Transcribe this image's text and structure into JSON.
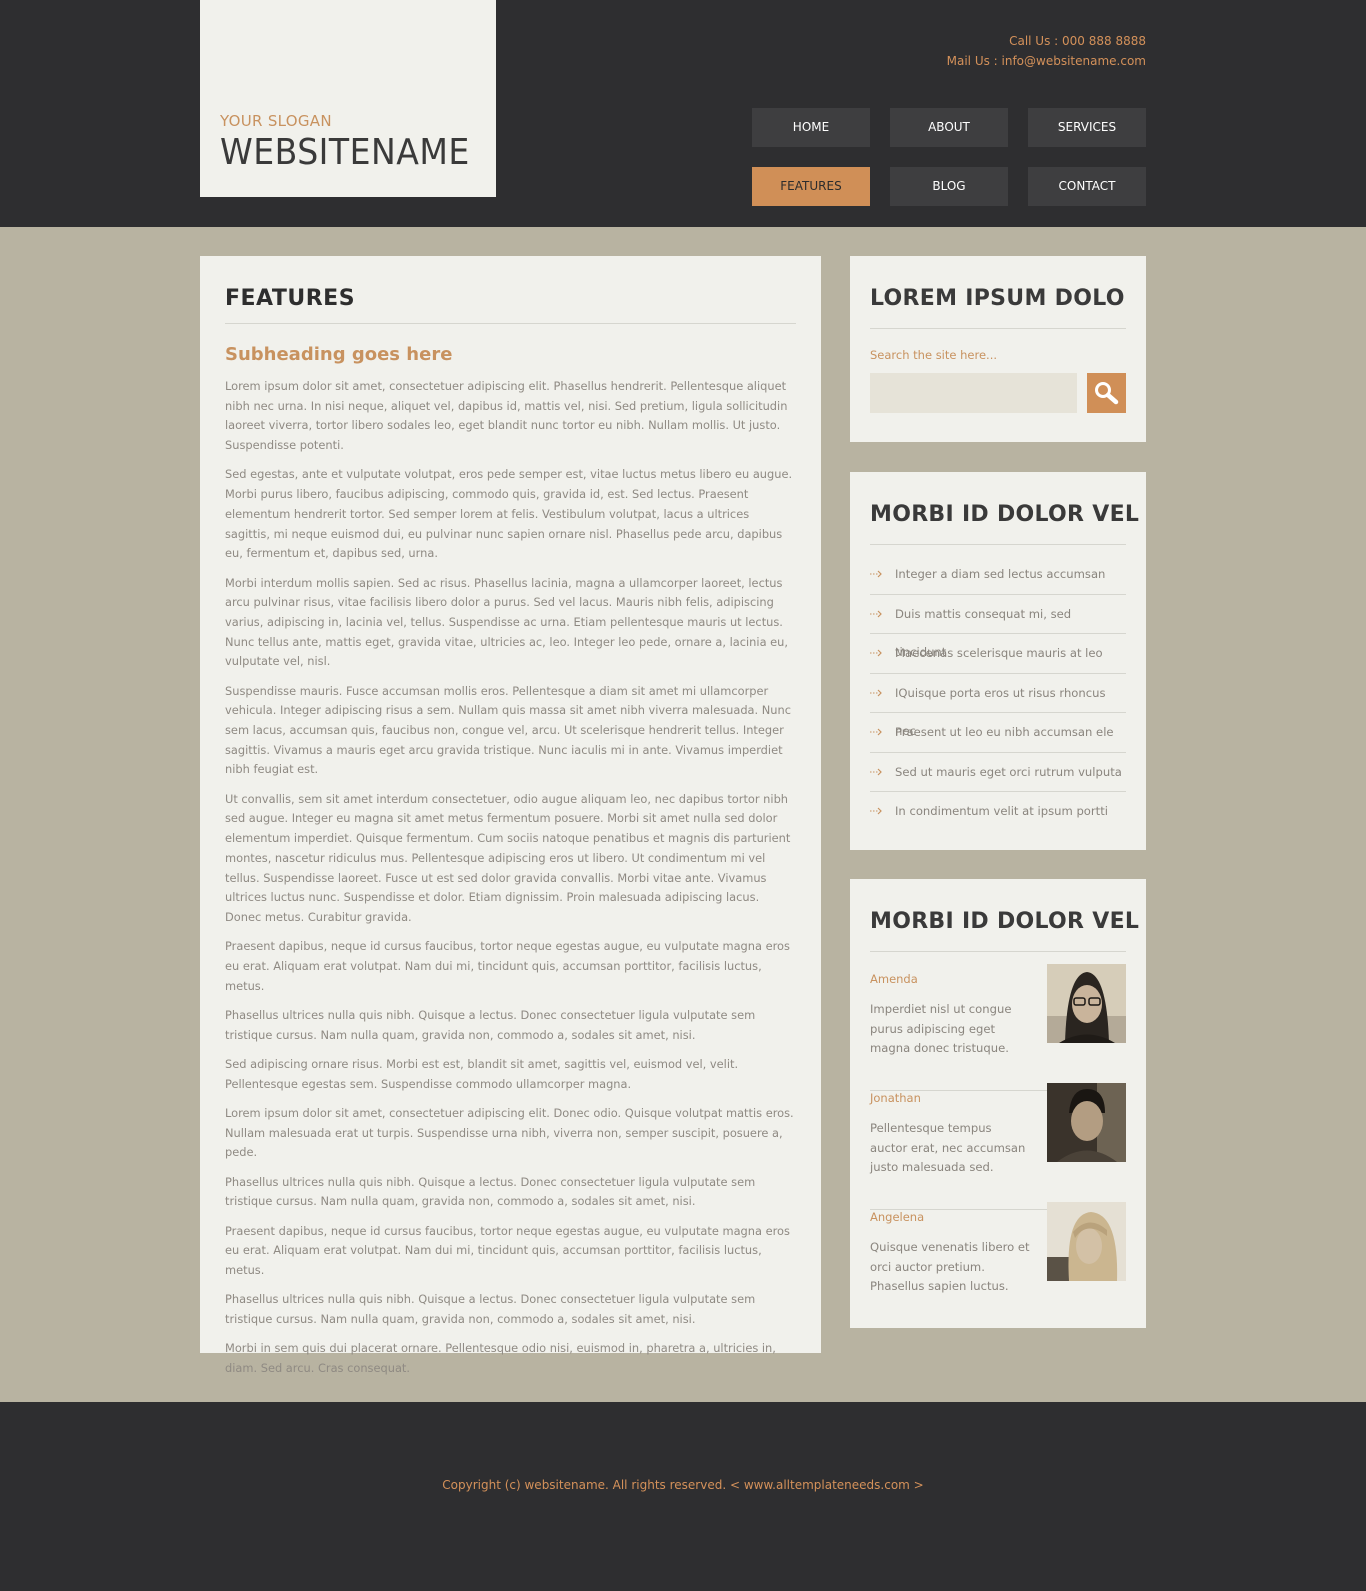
{
  "header": {
    "slogan": "YOUR SLOGAN",
    "site_name": "WEBSITENAME",
    "call_us": "Call Us : 000 888 8888",
    "mail_us": "Mail Us : info@websitename.com"
  },
  "nav": {
    "items": [
      "HOME",
      "ABOUT",
      "SERVICES",
      "FEATURES",
      "BLOG",
      "CONTACT"
    ],
    "active": "FEATURES"
  },
  "main": {
    "title": "FEATURES",
    "subheading": "Subheading goes here",
    "paragraphs": [
      "Lorem ipsum dolor sit amet, consectetuer adipiscing elit. Phasellus hendrerit. Pellentesque aliquet nibh nec urna. In nisi neque, aliquet vel, dapibus id, mattis vel, nisi. Sed pretium, ligula sollicitudin laoreet viverra, tortor libero sodales leo, eget blandit nunc tortor eu nibh. Nullam mollis. Ut justo. Suspendisse potenti.",
      "Sed egestas, ante et vulputate volutpat, eros pede semper est, vitae luctus metus libero eu augue. Morbi purus libero, faucibus adipiscing, commodo quis, gravida id, est. Sed lectus. Praesent elementum hendrerit tortor. Sed semper lorem at felis. Vestibulum volutpat, lacus a ultrices sagittis, mi neque euismod dui, eu pulvinar nunc sapien ornare nisl. Phasellus pede arcu, dapibus eu, fermentum et, dapibus sed, urna.",
      "Morbi interdum mollis sapien. Sed ac risus. Phasellus lacinia, magna a ullamcorper laoreet, lectus arcu pulvinar risus, vitae facilisis libero dolor a purus. Sed vel lacus. Mauris nibh felis, adipiscing varius, adipiscing in, lacinia vel, tellus. Suspendisse ac urna. Etiam pellentesque mauris ut lectus. Nunc tellus ante, mattis eget, gravida vitae, ultricies ac, leo. Integer leo pede, ornare a, lacinia eu, vulputate vel, nisl.",
      "Suspendisse mauris. Fusce accumsan mollis eros. Pellentesque a diam sit amet mi ullamcorper vehicula. Integer adipiscing risus a sem. Nullam quis massa sit amet nibh viverra malesuada. Nunc sem lacus, accumsan quis, faucibus non, congue vel, arcu. Ut scelerisque hendrerit tellus. Integer sagittis. Vivamus a mauris eget arcu gravida tristique. Nunc iaculis mi in ante. Vivamus imperdiet nibh feugiat est.",
      "Ut convallis, sem sit amet interdum consectetuer, odio augue aliquam leo, nec dapibus tortor nibh sed augue. Integer eu magna sit amet metus fermentum posuere. Morbi sit amet nulla sed dolor elementum imperdiet. Quisque fermentum. Cum sociis natoque penatibus et magnis dis parturient montes, nascetur ridiculus mus. Pellentesque adipiscing eros ut libero. Ut condimentum mi vel tellus. Suspendisse laoreet. Fusce ut est sed dolor gravida convallis. Morbi vitae ante. Vivamus ultrices luctus nunc. Suspendisse et dolor. Etiam dignissim. Proin malesuada adipiscing lacus. Donec metus. Curabitur gravida.",
      "Praesent dapibus, neque id cursus faucibus, tortor neque egestas augue, eu vulputate magna eros eu erat. Aliquam erat volutpat. Nam dui mi, tincidunt quis, accumsan porttitor, facilisis luctus, metus.",
      "Phasellus ultrices nulla quis nibh. Quisque a lectus. Donec consectetuer ligula vulputate sem tristique cursus. Nam nulla quam, gravida non, commodo a, sodales sit amet, nisi.",
      "Sed adipiscing ornare risus. Morbi est est, blandit sit amet, sagittis vel, euismod vel, velit. Pellentesque egestas sem. Suspendisse commodo ullamcorper magna.",
      "Lorem ipsum dolor sit amet, consectetuer adipiscing elit. Donec odio. Quisque volutpat mattis eros. Nullam malesuada erat ut turpis. Suspendisse urna nibh, viverra non, semper suscipit, posuere a, pede.",
      "Phasellus ultrices nulla quis nibh. Quisque a lectus. Donec consectetuer ligula vulputate sem tristique cursus. Nam nulla quam, gravida non, commodo a, sodales sit amet, nisi.",
      "Praesent dapibus, neque id cursus faucibus, tortor neque egestas augue, eu vulputate magna eros eu erat. Aliquam erat volutpat. Nam dui mi, tincidunt quis, accumsan porttitor, facilisis luctus, metus.",
      "Phasellus ultrices nulla quis nibh. Quisque a lectus. Donec consectetuer ligula vulputate sem tristique cursus. Nam nulla quam, gravida non, commodo a, sodales sit amet, nisi.",
      "Morbi in sem quis dui placerat ornare. Pellentesque odio nisi, euismod in, pharetra a, ultricies in, diam. Sed arcu. Cras consequat."
    ]
  },
  "sidebar": {
    "search": {
      "title": "LOREM IPSUM DOLO",
      "label": "Search the site here...",
      "value": "",
      "button_icon": "search-icon"
    },
    "links": {
      "title": "MORBI ID DOLOR VEL",
      "items": [
        "Integer a diam sed lectus accumsan",
        "Duis mattis consequat mi, sed tincidunt",
        "Maecenas scelerisque mauris at leo",
        "IQuisque porta eros ut risus rhoncus nec",
        "Praesent ut leo eu nibh accumsan ele",
        "Sed ut mauris eget orci rutrum vulputa",
        "In condimentum velit at ipsum portti"
      ]
    },
    "people": {
      "title": "MORBI ID DOLOR VEL",
      "items": [
        {
          "name": "Amenda",
          "text": "Imperdiet nisl ut congue purus adipiscing eget magna donec tristuque."
        },
        {
          "name": "Jonathan",
          "text": "Pellentesque tempus auctor erat, nec accumsan justo malesuada sed."
        },
        {
          "name": "Angelena",
          "text": "Quisque venenatis libero et orci auctor pretium. Phasellus sapien luctus."
        }
      ]
    }
  },
  "footer": {
    "copyright": "Copyright (c) websitename. All rights reserved. < www.alltemplateneeds.com >"
  },
  "colors": {
    "accent": "#d08f57",
    "dark_bg": "#2e2e30",
    "page_bg": "#b8b3a1",
    "panel_bg": "#f1f1ec"
  }
}
